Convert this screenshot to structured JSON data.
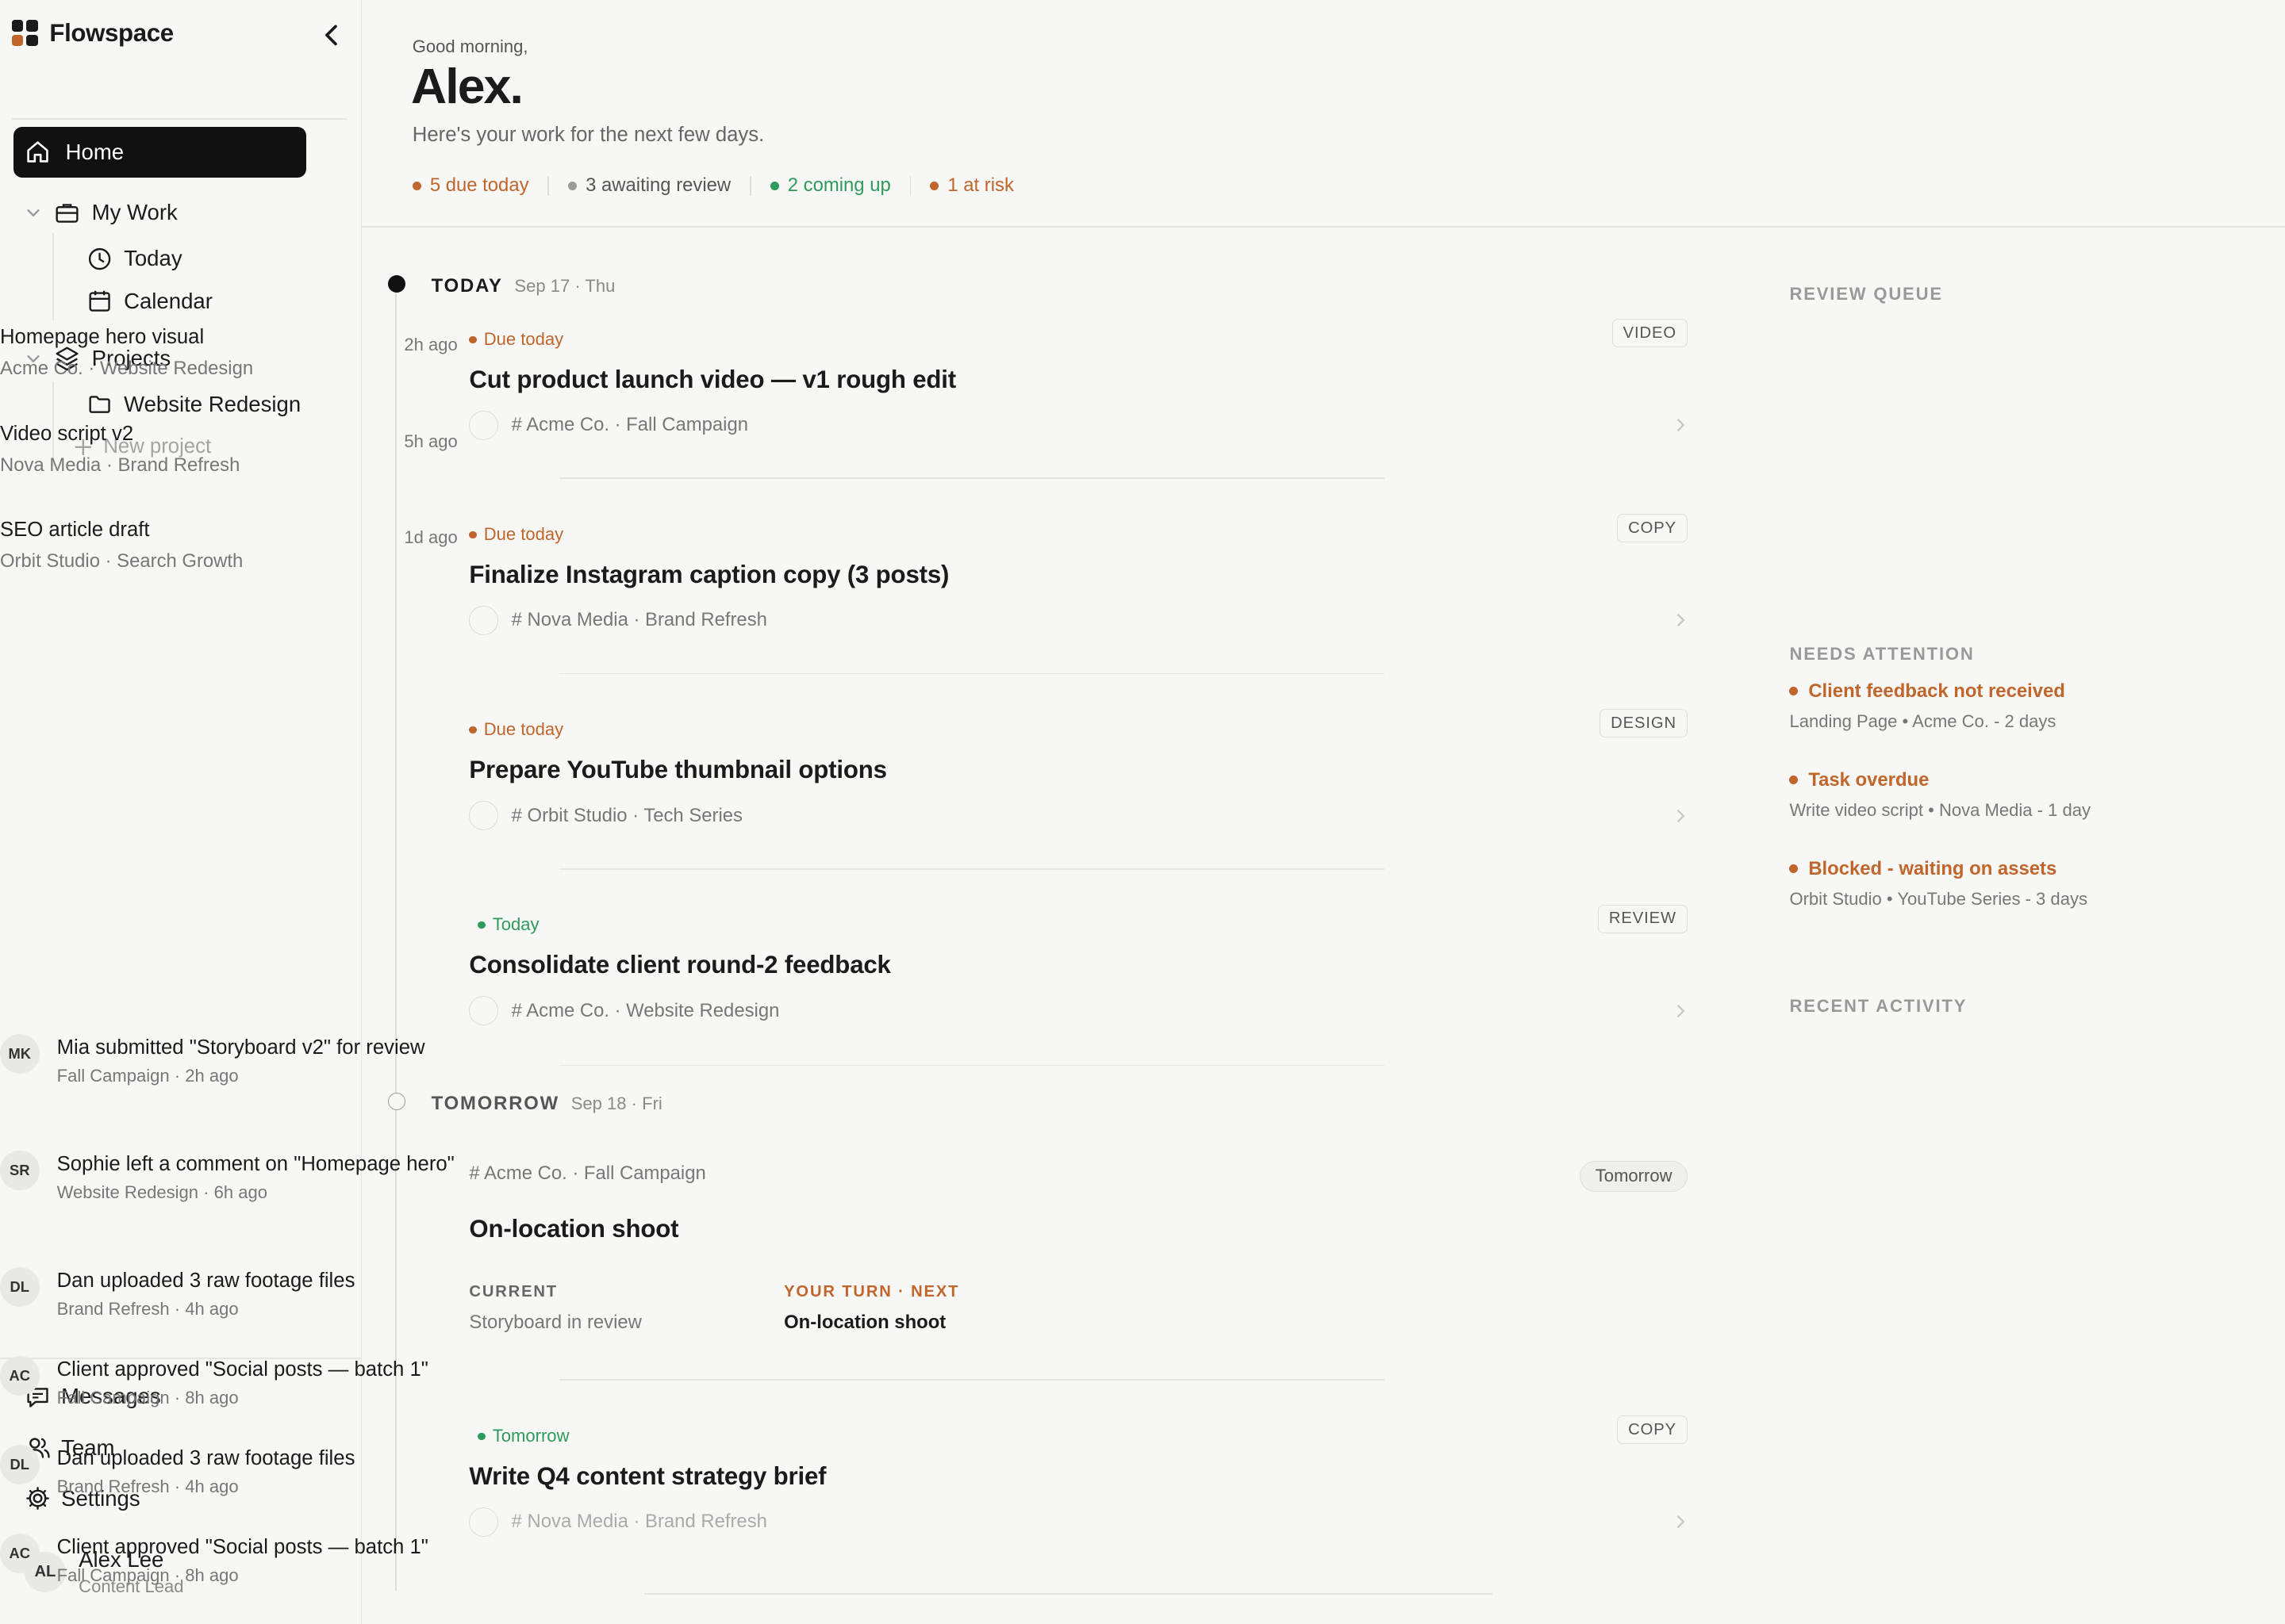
{
  "sidebar": {
    "brand": "Flowspace",
    "home": "Home",
    "my_work": "My Work",
    "today": "Today",
    "calendar": "Calendar",
    "projects": "Projects",
    "project_items": [
      "Website Redesign"
    ],
    "new_project": "New project",
    "messages": "Messages",
    "team": "Team",
    "settings": "Settings",
    "user": {
      "initials": "AL",
      "name": "Alex Lee",
      "role": "Content Lead"
    }
  },
  "header": {
    "greeting": "Good morning,",
    "name": "Alex.",
    "subtitle": "Here's your work for the next few days.",
    "stats": [
      {
        "label": "5 due today",
        "color": "#c0652b"
      },
      {
        "label": "3 awaiting review",
        "color": "#9a9a96"
      },
      {
        "label": "2 coming up",
        "color": "#2f9a5e"
      },
      {
        "label": "1 at risk",
        "color": "#c0652b"
      }
    ]
  },
  "timeline": {
    "today": {
      "label": "TODAY",
      "date": "Sep 17 · Thu"
    },
    "tomorrow": {
      "label": "TOMORROW",
      "date": "Sep 18 · Fri"
    },
    "tasks": [
      {
        "status": "Due today",
        "status_color": "#c0652b",
        "title": "Cut product launch video — v1 rough edit",
        "meta": "# Acme Co. · Fall Campaign",
        "tag": "VIDEO"
      },
      {
        "status": "Due today",
        "status_color": "#c0652b",
        "title": "Finalize Instagram caption copy (3 posts)",
        "meta": "# Nova Media · Brand Refresh",
        "tag": "COPY"
      },
      {
        "status": "Due today",
        "status_color": "#c0652b",
        "title": "Prepare YouTube thumbnail options",
        "meta": "# Orbit Studio · Tech Series",
        "tag": "DESIGN"
      },
      {
        "status": "Today",
        "status_color": "#2f9a5e",
        "title": "Consolidate client round-2 feedback",
        "meta": "# Acme Co. · Website Redesign",
        "tag": "REVIEW"
      }
    ],
    "shoot": {
      "meta": "# Acme Co. · Fall Campaign",
      "tag": "Tomorrow",
      "title": "On-location shoot",
      "current_label": "CURRENT",
      "current_value": "Storyboard in review",
      "next_label": "YOUR TURN · NEXT",
      "next_value": "On-location shoot"
    },
    "brief": {
      "status": "Tomorrow",
      "status_color": "#2f9a5e",
      "title": "Write Q4 content strategy brief",
      "meta": "# Nova Media · Brand Refresh",
      "tag": "COPY"
    }
  },
  "review_queue": {
    "heading": "REVIEW QUEUE",
    "items": [
      {
        "title": "Homepage hero visual",
        "sub": "Acme Co. · Website Redesign",
        "time": "2h ago"
      },
      {
        "title": "Video script v2",
        "sub": "Nova Media · Brand Refresh",
        "time": "5h ago"
      },
      {
        "title": "SEO article draft",
        "sub": "Orbit Studio · Search Growth",
        "time": "1d ago"
      }
    ]
  },
  "needs_attention": {
    "heading": "NEEDS ATTENTION",
    "items": [
      {
        "title": "Client feedback not received",
        "sub": "Landing Page • Acme Co. - 2 days"
      },
      {
        "title": "Task overdue",
        "sub": "Write video script • Nova Media - 1 day"
      },
      {
        "title": "Blocked - waiting on assets",
        "sub": "Orbit Studio • YouTube Series - 3 days"
      }
    ]
  },
  "recent_activity": {
    "heading": "RECENT ACTIVITY",
    "items": [
      {
        "initials": "MK",
        "title": "Mia submitted \"Storyboard v2\" for review",
        "sub": "Fall Campaign · 2h ago"
      },
      {
        "initials": "SR",
        "title": "Sophie left a comment on \"Homepage hero\"",
        "sub": "Website Redesign · 6h ago"
      },
      {
        "initials": "DL",
        "title": "Dan uploaded 3 raw footage files",
        "sub": "Brand Refresh · 4h ago"
      },
      {
        "initials": "AC",
        "title": "Client approved \"Social posts — batch 1\"",
        "sub": "Fall Campaign · 8h ago"
      },
      {
        "initials": "DL",
        "title": "Dan uploaded 3 raw footage files",
        "sub": "Brand Refresh · 4h ago"
      },
      {
        "initials": "AC",
        "title": "Client approved \"Social posts — batch 1\"",
        "sub": "Fall Campaign · 8h ago"
      }
    ]
  }
}
